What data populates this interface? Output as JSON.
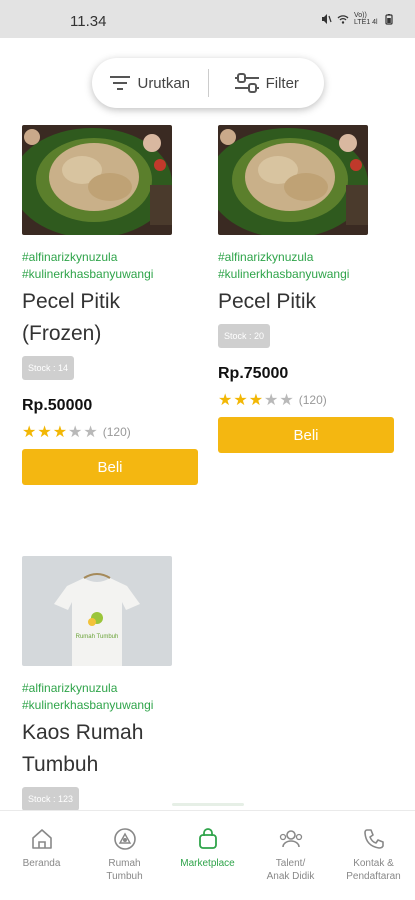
{
  "status_bar": {
    "time": "11.34",
    "net": "Vo)) LTE1 4l"
  },
  "toolbar": {
    "sort_label": "Urutkan",
    "filter_label": "Filter"
  },
  "products": [
    {
      "tag1": "#alfinarizkynuzula",
      "tag2": "#kulinerkhasbanyuwangi",
      "title_line1": "Pecel Pitik",
      "title_line2": "(Frozen)",
      "stock": "Stock : 14",
      "price": "Rp.50000",
      "stars": 3,
      "rating_count": "(120)",
      "buy_label": "Beli"
    },
    {
      "tag1": "#alfinarizkynuzula",
      "tag2": "#kulinerkhasbanyuwangi",
      "title_line1": "Pecel Pitik",
      "title_line2": "",
      "stock": "Stock : 20",
      "price": "Rp.75000",
      "stars": 3,
      "rating_count": "(120)",
      "buy_label": "Beli"
    },
    {
      "tag1": "#alfinarizkynuzula",
      "tag2": "#kulinerkhasbanyuwangi",
      "title_line1": "Kaos Rumah",
      "title_line2": "Tumbuh",
      "stock": "Stock : 123",
      "shirt_logo_text": "Rumah Tumbuh"
    }
  ],
  "nav": [
    {
      "label_line1": "Beranda",
      "label_line2": "",
      "icon": "home-icon"
    },
    {
      "label_line1": "Rumah",
      "label_line2": "Tumbuh",
      "icon": "building-icon"
    },
    {
      "label_line1": "Marketplace",
      "label_line2": "",
      "icon": "shopping-bag-icon",
      "active": true
    },
    {
      "label_line1": "Talent/",
      "label_line2": "Anak Didik",
      "icon": "people-icon"
    },
    {
      "label_line1": "Kontak &",
      "label_line2": "Pendaftaran",
      "icon": "phone-icon"
    }
  ],
  "colors": {
    "accent_green": "#2fa44a",
    "button_yellow": "#f4b711",
    "star": "#f2b705"
  }
}
